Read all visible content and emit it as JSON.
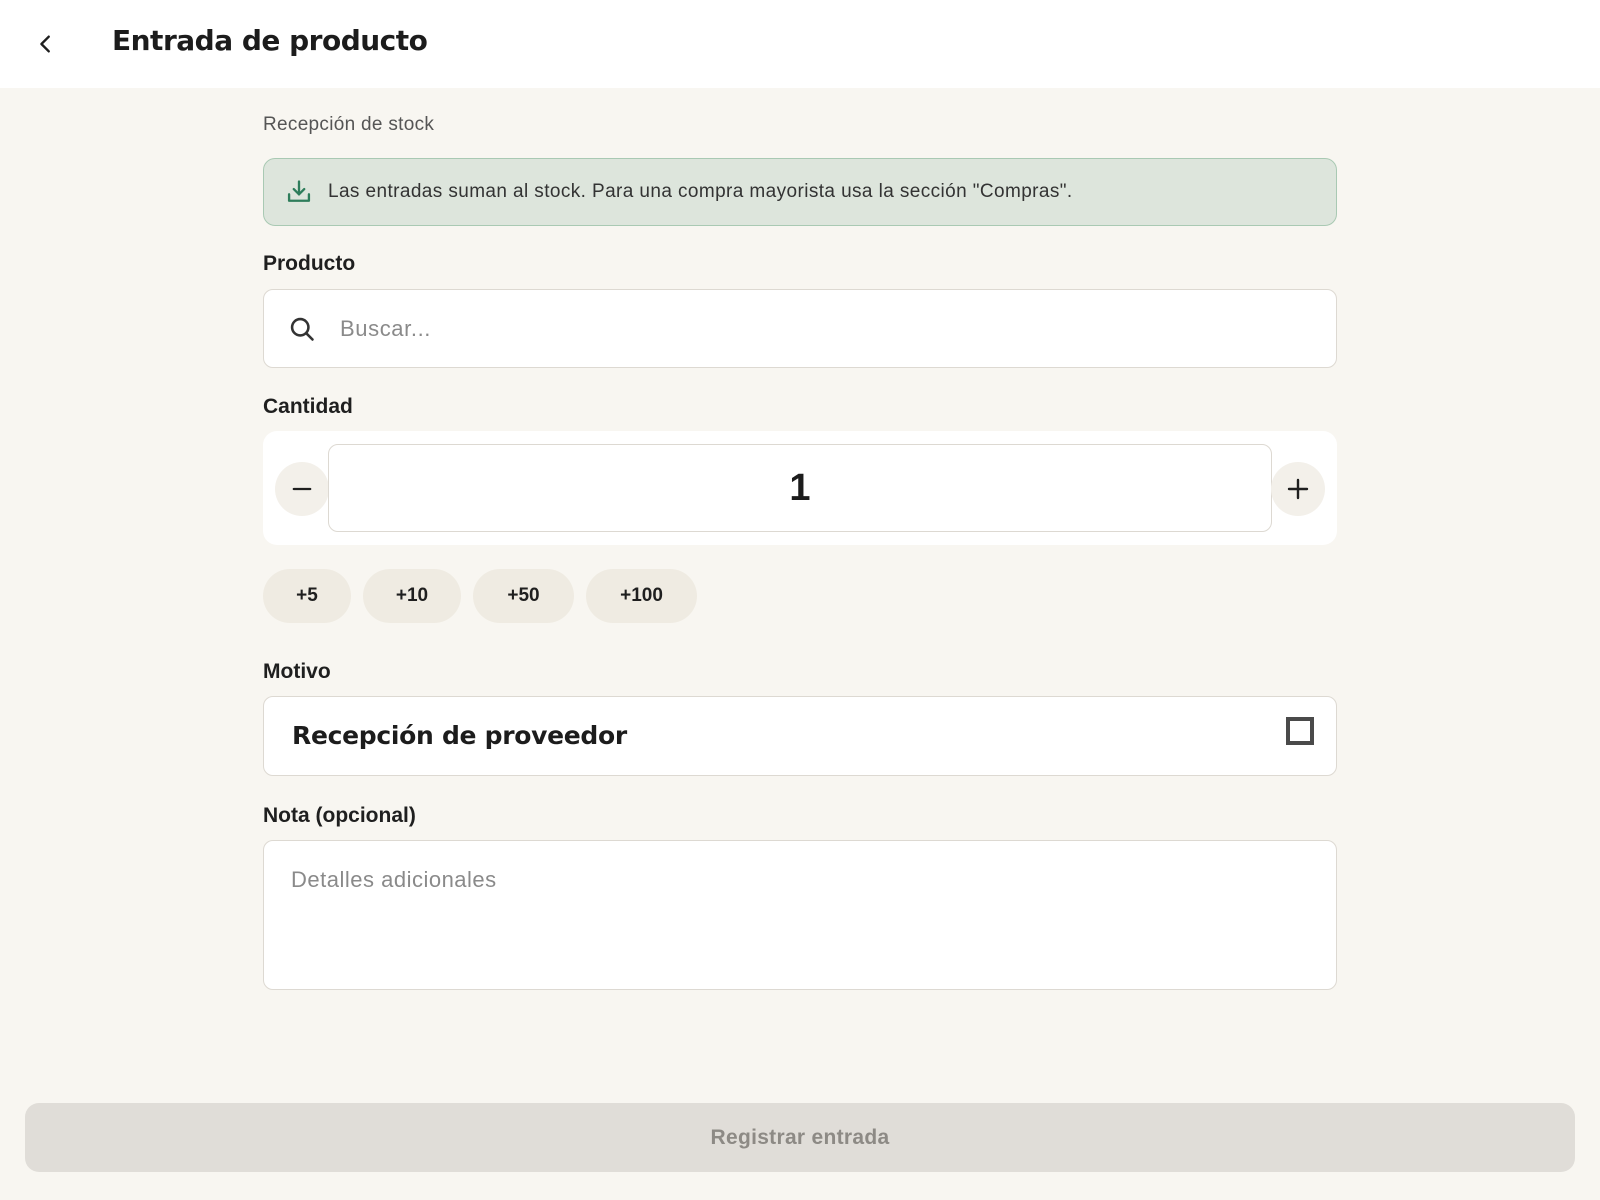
{
  "header": {
    "title": "Entrada de producto",
    "back_icon": "chevron-left-icon"
  },
  "section": {
    "label": "Recepción de stock"
  },
  "info_banner": {
    "icon": "download-tray-icon",
    "text": "Las entradas suman al stock. Para una compra mayorista usa la sección \"Compras\".",
    "accent_color": "#2e7d5b"
  },
  "product": {
    "label": "Producto",
    "search_icon": "search-icon",
    "placeholder": "Buscar...",
    "value": ""
  },
  "quantity": {
    "label": "Cantidad",
    "value": "1",
    "decrement_label": "−",
    "increment_label": "+",
    "quick_add": [
      "+5",
      "+10",
      "+50",
      "+100"
    ]
  },
  "reason": {
    "label": "Motivo",
    "selected": "Recepción de proveedor"
  },
  "note": {
    "label": "Nota (opcional)",
    "placeholder": "Detalles adicionales",
    "value": ""
  },
  "submit": {
    "label": "Registrar entrada",
    "enabled": false
  }
}
